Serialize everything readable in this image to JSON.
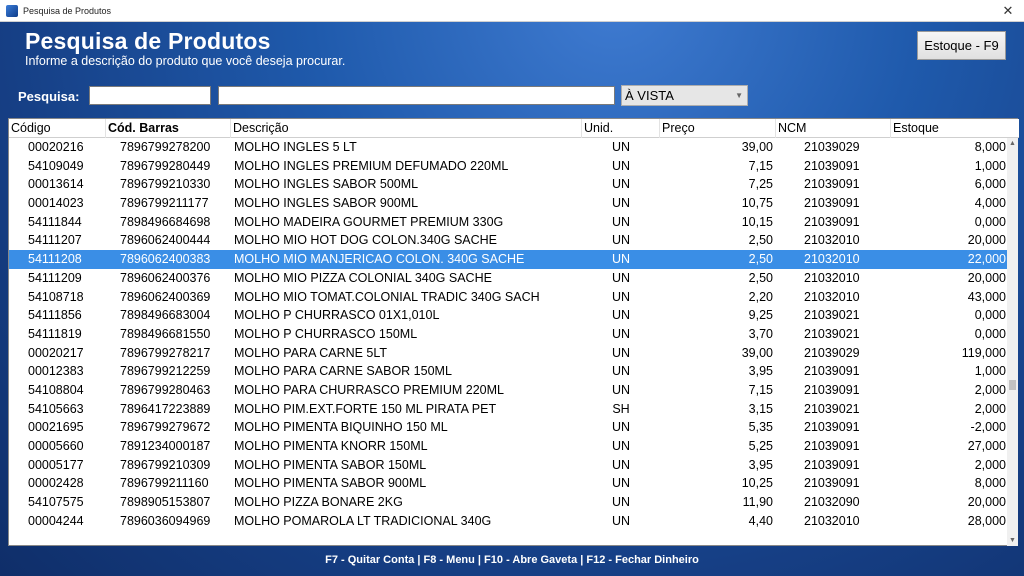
{
  "window": {
    "title": "Pesquisa de Produtos",
    "close_glyph": "✕"
  },
  "header": {
    "title": "Pesquisa de Produtos",
    "subtitle": "Informe a descrição do produto que você deseja procurar."
  },
  "estoque_button": "Estoque - F9",
  "search": {
    "label": "Pesquisa:",
    "code_value": "",
    "text_value": "",
    "price_mode": "À VISTA"
  },
  "table": {
    "columns": [
      "Código",
      "Cód. Barras",
      "Descrição",
      "Unid.",
      "Preço",
      "NCM",
      "Estoque"
    ],
    "selected_row": 6,
    "rows": [
      [
        "00020216",
        "7896799278200",
        "MOLHO INGLES 5 LT",
        "UN",
        "39,00",
        "21039029",
        "8,000"
      ],
      [
        "54109049",
        "7896799280449",
        "MOLHO INGLES PREMIUM DEFUMADO 220ML",
        "UN",
        "7,15",
        "21039091",
        "1,000"
      ],
      [
        "00013614",
        "7896799210330",
        "MOLHO INGLES SABOR 500ML",
        "UN",
        "7,25",
        "21039091",
        "6,000"
      ],
      [
        "00014023",
        "7896799211177",
        "MOLHO INGLES SABOR 900ML",
        "UN",
        "10,75",
        "21039091",
        "4,000"
      ],
      [
        "54111844",
        "7898496684698",
        "MOLHO MADEIRA GOURMET PREMIUM 330G",
        "UN",
        "10,15",
        "21039091",
        "0,000"
      ],
      [
        "54111207",
        "7896062400444",
        "MOLHO MIO HOT DOG COLON.340G SACHE",
        "UN",
        "2,50",
        "21032010",
        "20,000"
      ],
      [
        "54111208",
        "7896062400383",
        "MOLHO MIO MANJERICAO COLON. 340G SACHE",
        "UN",
        "2,50",
        "21032010",
        "22,000"
      ],
      [
        "54111209",
        "7896062400376",
        "MOLHO MIO PIZZA COLONIAL 340G SACHE",
        "UN",
        "2,50",
        "21032010",
        "20,000"
      ],
      [
        "54108718",
        "7896062400369",
        "MOLHO MIO TOMAT.COLONIAL TRADIC 340G SACH",
        "UN",
        "2,20",
        "21032010",
        "43,000"
      ],
      [
        "54111856",
        "7898496683004",
        "MOLHO P  CHURRASCO 01X1,010L",
        "UN",
        "9,25",
        "21039021",
        "0,000"
      ],
      [
        "54111819",
        "7898496681550",
        "MOLHO P  CHURRASCO 150ML",
        "UN",
        "3,70",
        "21039021",
        "0,000"
      ],
      [
        "00020217",
        "7896799278217",
        "MOLHO PARA CARNE 5LT",
        "UN",
        "39,00",
        "21039029",
        "119,000"
      ],
      [
        "00012383",
        "7896799212259",
        "MOLHO PARA CARNE SABOR 150ML",
        "UN",
        "3,95",
        "21039091",
        "1,000"
      ],
      [
        "54108804",
        "7896799280463",
        "MOLHO PARA CHURRASCO PREMIUM 220ML",
        "UN",
        "7,15",
        "21039091",
        "2,000"
      ],
      [
        "54105663",
        "7896417223889",
        "MOLHO PIM.EXT.FORTE 150 ML PIRATA PET",
        "SH",
        "3,15",
        "21039021",
        "2,000"
      ],
      [
        "00021695",
        "7896799279672",
        "MOLHO PIMENTA BIQUINHO 150 ML",
        "UN",
        "5,35",
        "21039091",
        "-2,000"
      ],
      [
        "00005660",
        "7891234000187",
        "MOLHO PIMENTA KNORR 150ML",
        "UN",
        "5,25",
        "21039091",
        "27,000"
      ],
      [
        "00005177",
        "7896799210309",
        "MOLHO PIMENTA SABOR 150ML",
        "UN",
        "3,95",
        "21039091",
        "2,000"
      ],
      [
        "00002428",
        "7896799211160",
        "MOLHO PIMENTA SABOR 900ML",
        "UN",
        "10,25",
        "21039091",
        "8,000"
      ],
      [
        "54107575",
        "7898905153807",
        "MOLHO PIZZA BONARE 2KG",
        "UN",
        "11,90",
        "21032090",
        "20,000"
      ],
      [
        "00004244",
        "7896036094969",
        "MOLHO POMAROLA LT TRADICIONAL 340G",
        "UN",
        "4,40",
        "21032010",
        "28,000"
      ]
    ]
  },
  "footer": "F7 - Quitar Conta  |  F8 - Menu  |  F10 - Abre Gaveta  |  F12 - Fechar Dinheiro",
  "colors": {
    "background": "#1d4f9c",
    "selection": "#3a8ee6"
  }
}
